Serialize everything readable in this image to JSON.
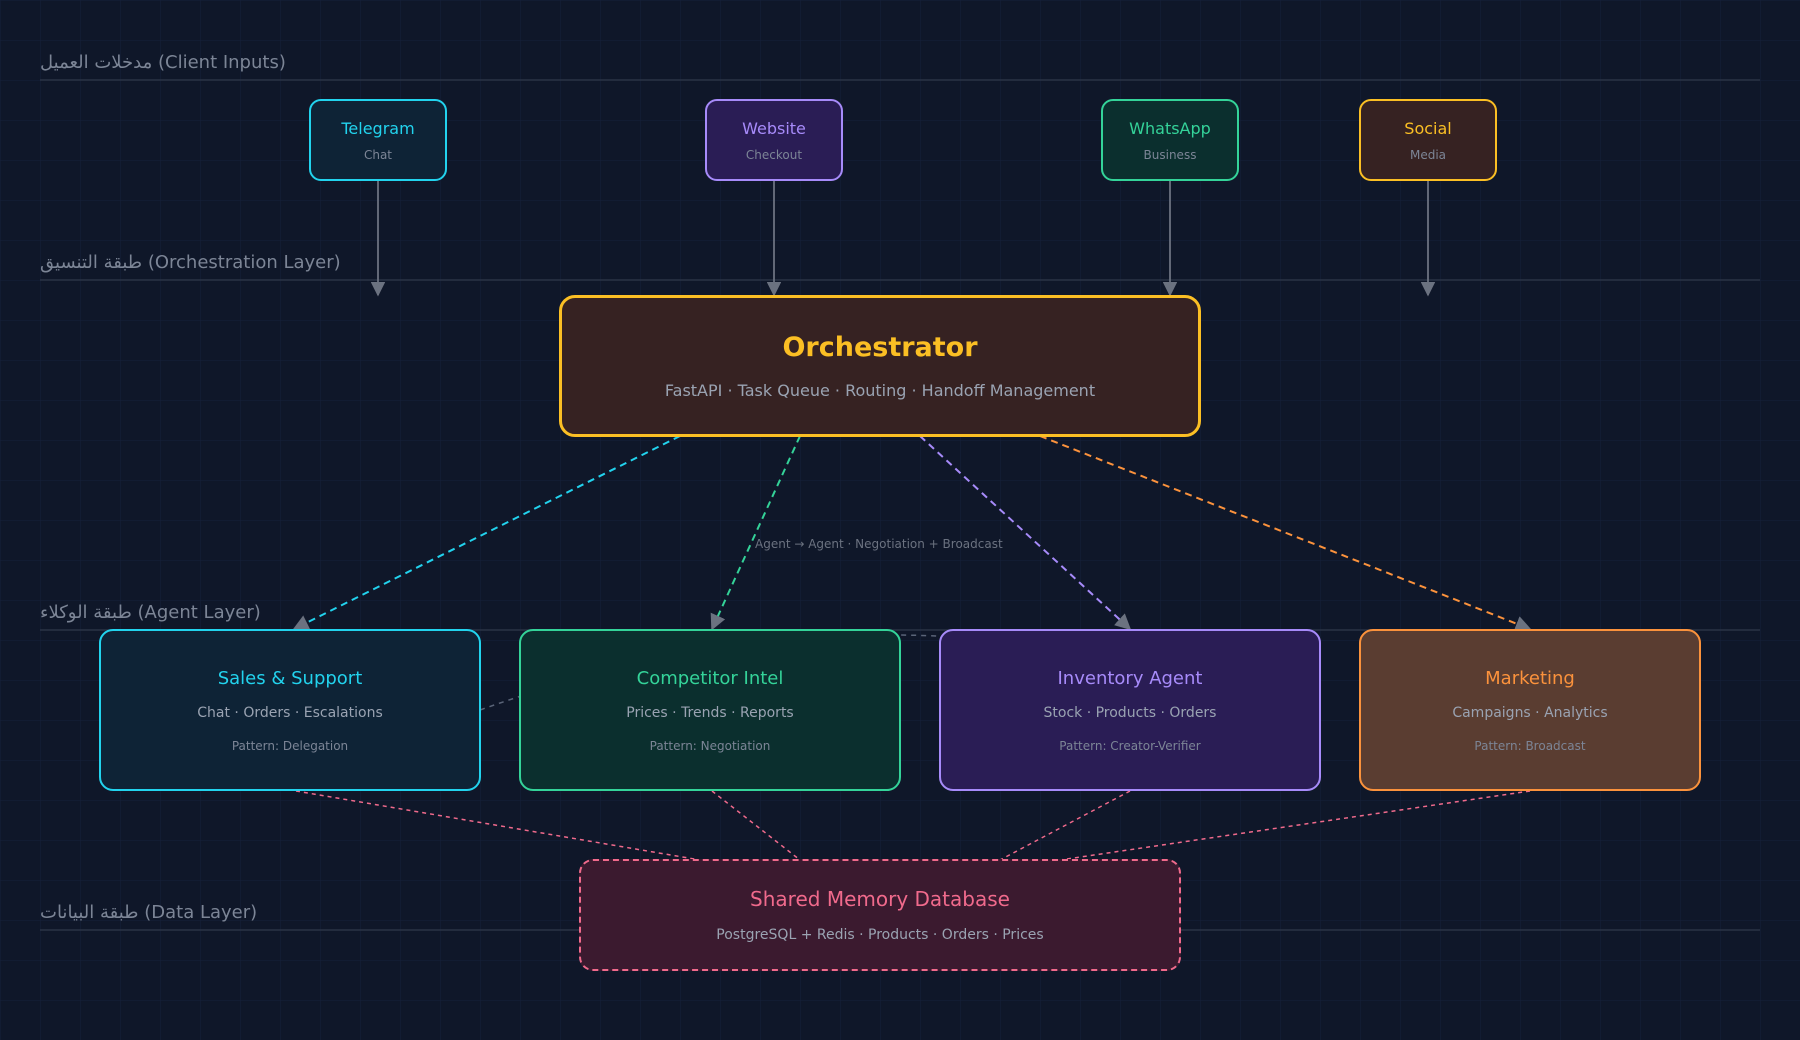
{
  "layers": {
    "client": "مدخلات العميل (Client Inputs)",
    "orchestration": "طبقة التنسيق (Orchestration Layer)",
    "agent": "طبقة الوكلاء (Agent Layer)",
    "data": "طبقة البيانات (Data Layer)"
  },
  "inputs": [
    {
      "title": "Telegram",
      "subtitle": "Chat"
    },
    {
      "title": "Website",
      "subtitle": "Checkout"
    },
    {
      "title": "WhatsApp",
      "subtitle": "Business"
    },
    {
      "title": "Social",
      "subtitle": "Media"
    }
  ],
  "orchestrator": {
    "title": "Orchestrator",
    "subtitle": "FastAPI · Task Queue · Routing · Handoff Management"
  },
  "link_note": "Agent → Agent · Negotiation + Broadcast",
  "agents": [
    {
      "title": "Sales & Support",
      "subtitle": "Chat · Orders · Escalations",
      "pattern": "Pattern: Delegation"
    },
    {
      "title": "Competitor Intel",
      "subtitle": "Prices · Trends · Reports",
      "pattern": "Pattern: Negotiation"
    },
    {
      "title": "Inventory Agent",
      "subtitle": "Stock · Products · Orders",
      "pattern": "Pattern: Creator-Verifier"
    },
    {
      "title": "Marketing",
      "subtitle": "Campaigns · Analytics",
      "pattern": "Pattern: Broadcast"
    }
  ],
  "database": {
    "title": "Shared Memory Database",
    "subtitle": "PostgreSQL + Redis · Products · Orders · Prices"
  },
  "colors": {
    "background": "#0f1729",
    "cyan": "#22d3ee",
    "purple": "#a78bfa",
    "green": "#34d399",
    "amber": "#fbbf24",
    "orange": "#fb923c",
    "pink": "#f06a8c",
    "connector": "#6b7280"
  }
}
